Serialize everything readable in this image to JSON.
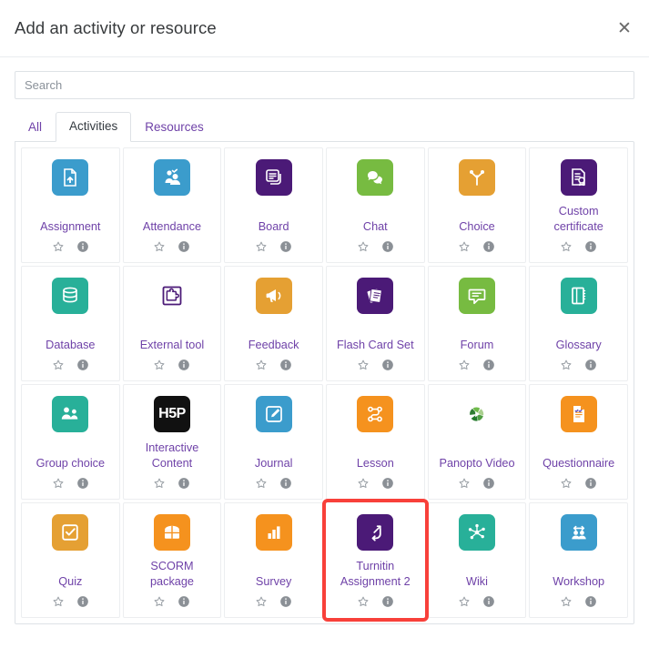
{
  "header": {
    "title": "Add an activity or resource",
    "close_label": "✕"
  },
  "search": {
    "placeholder": "Search",
    "value": ""
  },
  "tabs": [
    {
      "label": "All",
      "active": false
    },
    {
      "label": "Activities",
      "active": true
    },
    {
      "label": "Resources",
      "active": false
    }
  ],
  "colors": {
    "accent_purple": "#6f42a8",
    "highlight_red": "#f8403a",
    "blue": "#3b9ccc",
    "purple": "#4b1a77",
    "green": "#77bb41",
    "orange_dark": "#e5a033",
    "teal": "#28b099",
    "orange": "#f5921e",
    "black": "#111111",
    "panopto_green": "#37863b"
  },
  "card_actions": {
    "star_name": "Add to starred",
    "info_name": "Show more information"
  },
  "items": [
    {
      "label": "Assignment",
      "icon": "assignment-icon",
      "bg": "#3b9ccc",
      "highlighted": false
    },
    {
      "label": "Attendance",
      "icon": "attendance-icon",
      "bg": "#3b9ccc",
      "highlighted": false
    },
    {
      "label": "Board",
      "icon": "board-icon",
      "bg": "#4b1a77",
      "highlighted": false
    },
    {
      "label": "Chat",
      "icon": "chat-icon",
      "bg": "#77bb41",
      "highlighted": false
    },
    {
      "label": "Choice",
      "icon": "choice-icon",
      "bg": "#e5a033",
      "highlighted": false
    },
    {
      "label": "Custom certificate",
      "icon": "custom-certificate-icon",
      "bg": "#4b1a77",
      "highlighted": false
    },
    {
      "label": "Database",
      "icon": "database-icon",
      "bg": "#28b099",
      "highlighted": false
    },
    {
      "label": "External tool",
      "icon": "external-tool-icon",
      "bg": "#ffffff",
      "highlighted": false
    },
    {
      "label": "Feedback",
      "icon": "feedback-icon",
      "bg": "#e5a033",
      "highlighted": false
    },
    {
      "label": "Flash Card Set",
      "icon": "flash-card-set-icon",
      "bg": "#4b1a77",
      "highlighted": false
    },
    {
      "label": "Forum",
      "icon": "forum-icon",
      "bg": "#77bb41",
      "highlighted": false
    },
    {
      "label": "Glossary",
      "icon": "glossary-icon",
      "bg": "#28b099",
      "highlighted": false
    },
    {
      "label": "Group choice",
      "icon": "group-choice-icon",
      "bg": "#28b099",
      "highlighted": false
    },
    {
      "label": "Interactive Content",
      "icon": "h5p-icon",
      "bg": "#111111",
      "highlighted": false
    },
    {
      "label": "Journal",
      "icon": "journal-icon",
      "bg": "#3b9ccc",
      "highlighted": false
    },
    {
      "label": "Lesson",
      "icon": "lesson-icon",
      "bg": "#f5921e",
      "highlighted": false
    },
    {
      "label": "Panopto Video",
      "icon": "panopto-video-icon",
      "bg": "transparent",
      "highlighted": false
    },
    {
      "label": "Questionnaire",
      "icon": "questionnaire-icon",
      "bg": "#f5921e",
      "highlighted": false
    },
    {
      "label": "Quiz",
      "icon": "quiz-icon",
      "bg": "#e5a033",
      "highlighted": false
    },
    {
      "label": "SCORM package",
      "icon": "scorm-package-icon",
      "bg": "#f5921e",
      "highlighted": false
    },
    {
      "label": "Survey",
      "icon": "survey-icon",
      "bg": "#f5921e",
      "highlighted": false
    },
    {
      "label": "Turnitin Assignment 2",
      "icon": "turnitin-assignment-icon",
      "bg": "#4b1a77",
      "highlighted": true
    },
    {
      "label": "Wiki",
      "icon": "wiki-icon",
      "bg": "#28b099",
      "highlighted": false
    },
    {
      "label": "Workshop",
      "icon": "workshop-icon",
      "bg": "#3b9ccc",
      "highlighted": false
    }
  ]
}
